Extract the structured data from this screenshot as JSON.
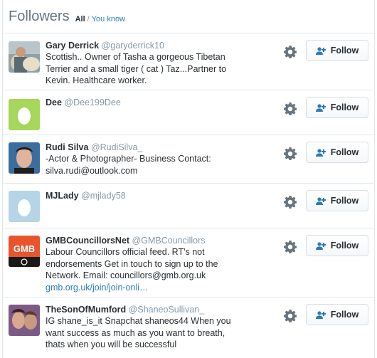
{
  "header": {
    "title": "Followers",
    "filter_all": "All",
    "separator": "/",
    "filter_you_know": "You know"
  },
  "colors": {
    "link": "#2b7bb9",
    "egg_green": "#a6d65a",
    "egg_blue": "#b5d4e6",
    "gmb_orange": "#e8542c"
  },
  "follow_label": "Follow",
  "followers": [
    {
      "name": "Gary Derrick",
      "handle": "@garyderrick10",
      "bio": [
        "Scottish.. Owner of Tasha a gorgeous Tibetan",
        "Terrier and a small tiger ( cat ) Taz...Partner to",
        "Kevin. Healthcare worker."
      ],
      "link": "",
      "avatar": "photo-man-with-dog"
    },
    {
      "name": "Dee",
      "handle": "@Dee199Dee",
      "bio": [],
      "link": "",
      "avatar": "default-egg-green"
    },
    {
      "name": "Rudi Silva",
      "handle": "@RudiSilva_",
      "bio": [
        "-Actor & Photographer- Business Contact:",
        "silva.rudi@outlook.com"
      ],
      "link": "",
      "avatar": "photo-young-man"
    },
    {
      "name": "MJLady",
      "handle": "@mjlady58",
      "bio": [],
      "link": "",
      "avatar": "default-egg-blue"
    },
    {
      "name": "GMBCouncillorsNet",
      "handle": "@GMBCouncillors",
      "bio": [
        "Labour Councillors official feed. RT's not",
        "endorsements Get in touch to sign up to the",
        "Network. Email: councillors@gmb.org.uk"
      ],
      "link": "gmb.org.uk/join/join-onli…",
      "avatar": "gmb-logo"
    },
    {
      "name": "TheSonOfMumford",
      "handle": "@ShaneoSullivan_",
      "bio": [
        "IG shane_is_it Snapchat shaneos44 When you",
        "want success as much as you want to breath,",
        "thats when you will be successful"
      ],
      "link": "",
      "avatar": "photo-selfie-couple"
    }
  ]
}
